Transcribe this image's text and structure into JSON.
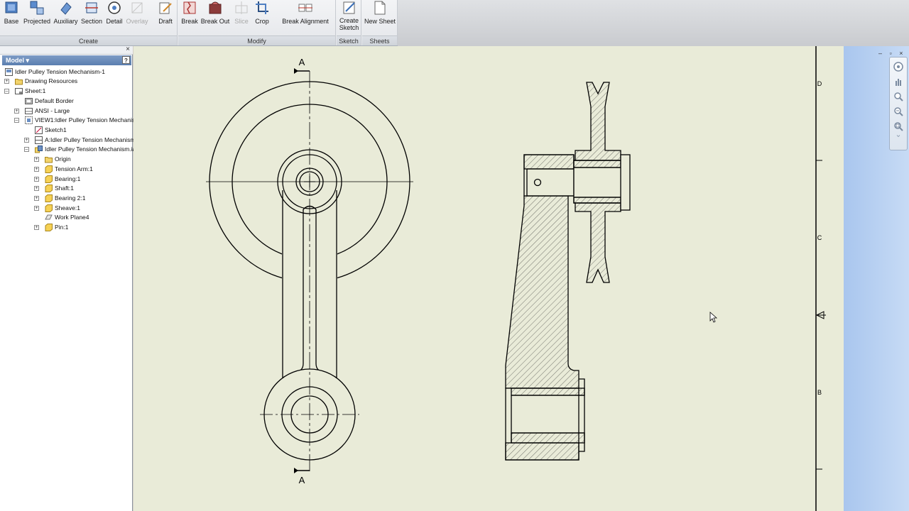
{
  "ribbon": {
    "panels": [
      {
        "title": "Create"
      },
      {
        "title": "Modify"
      },
      {
        "title": "Sketch"
      },
      {
        "title": "Sheets"
      }
    ],
    "tools": {
      "base": "Base",
      "projected": "Projected",
      "auxiliary": "Auxiliary",
      "section": "Section",
      "detail": "Detail",
      "overlay": "Overlay",
      "draft": "Draft",
      "break": "Break",
      "break_out": "Break Out",
      "slice": "Slice",
      "crop": "Crop",
      "break_alignment": "Break Alignment",
      "create_sketch_line1": "Create",
      "create_sketch_line2": "Sketch",
      "new_sheet": "New Sheet"
    }
  },
  "browser": {
    "title": "Model",
    "dropdown_glyph": "▾",
    "close_glyph": "×",
    "help_glyph": "?",
    "tree": [
      {
        "label": "Idler Pulley Tension Mechanism-1"
      },
      {
        "label": "Drawing Resources"
      },
      {
        "label": "Sheet:1"
      },
      {
        "label": "Default Border"
      },
      {
        "label": "ANSI - Large"
      },
      {
        "label": "VIEW1:Idler Pulley Tension Mechanis"
      },
      {
        "label": "Sketch1"
      },
      {
        "label": "A:Idler Pulley Tension Mechanism"
      },
      {
        "label": "Idler Pulley Tension Mechanism.ia"
      },
      {
        "label": "Origin"
      },
      {
        "label": "Tension Arm:1"
      },
      {
        "label": "Bearing:1"
      },
      {
        "label": "Shaft:1"
      },
      {
        "label": "Bearing 2:1"
      },
      {
        "label": "Sheave:1"
      },
      {
        "label": "Work Plane4"
      },
      {
        "label": "Pin:1"
      }
    ]
  },
  "drawing": {
    "section_label_top": "A",
    "section_label_bottom": "A",
    "zone_d": "D",
    "zone_c": "C",
    "zone_b": "B"
  },
  "window": {
    "controls": "– ▫ ×"
  },
  "colors": {
    "canvas": "#e9ebd8",
    "ribbon_accent": "#5b7fb0",
    "blue_strip": "#b6cff1"
  }
}
